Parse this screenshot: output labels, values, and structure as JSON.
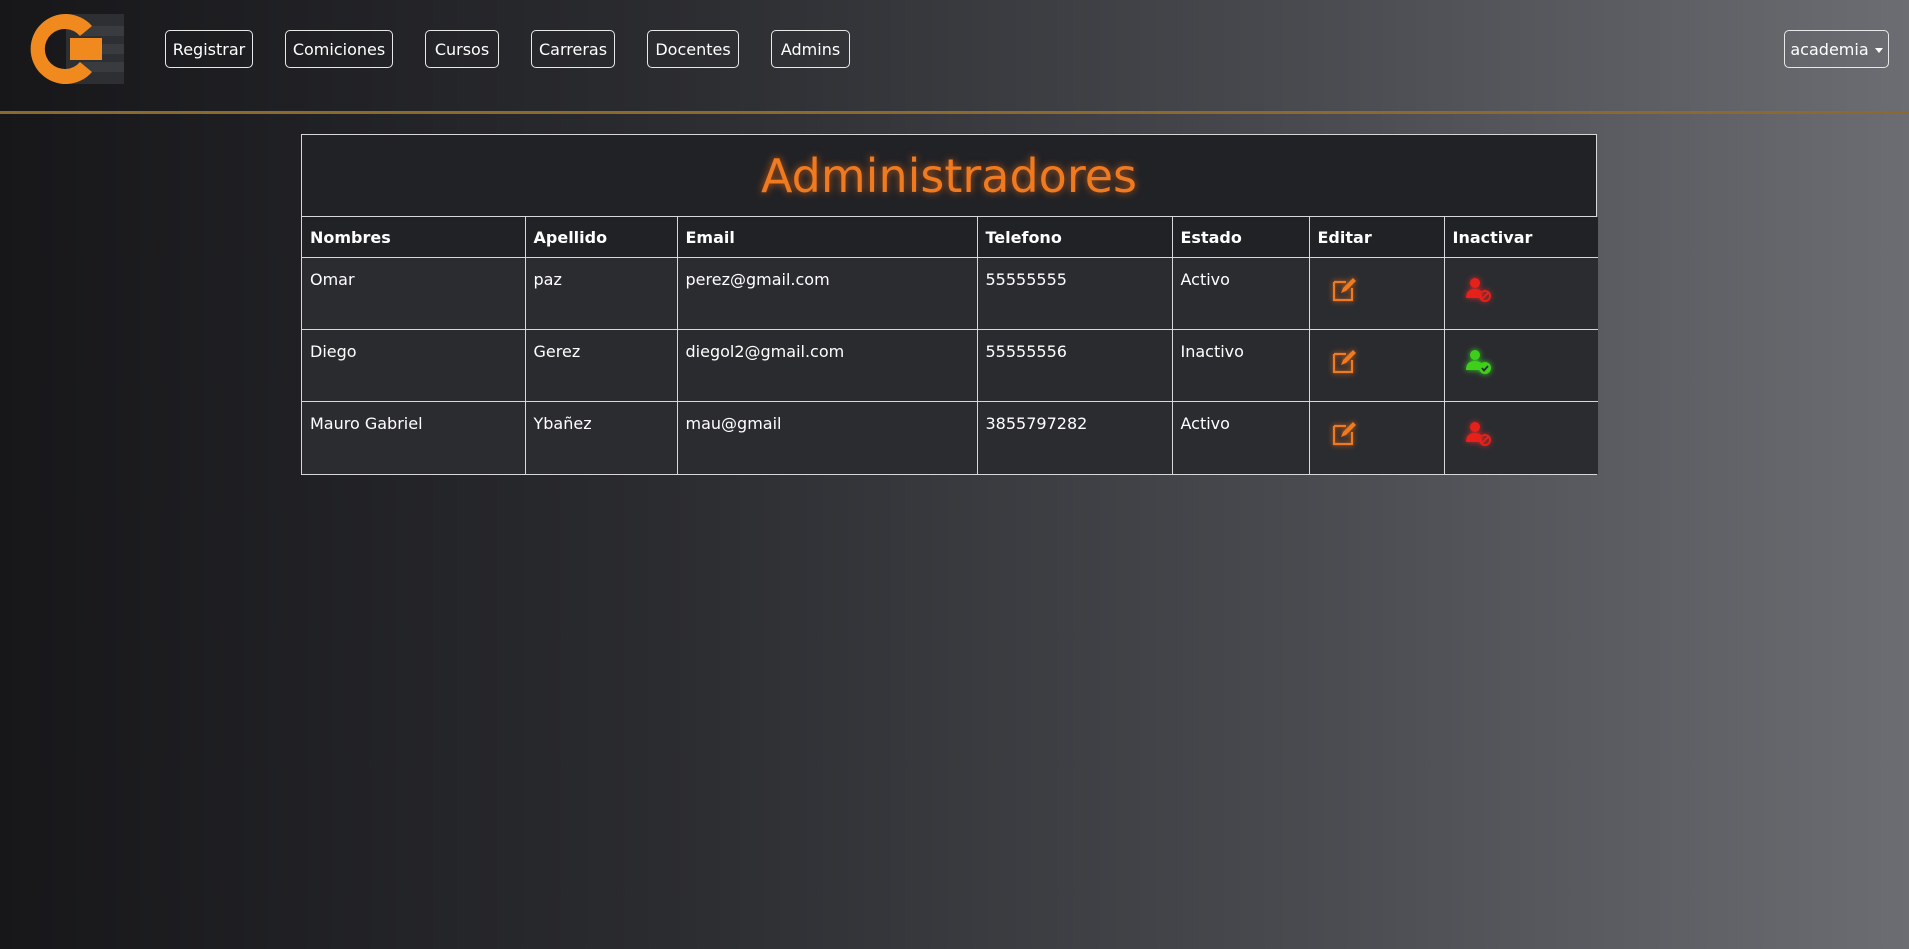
{
  "nav": {
    "items": [
      {
        "label": "Registrar"
      },
      {
        "label": "Comiciones"
      },
      {
        "label": "Cursos"
      },
      {
        "label": "Carreras"
      },
      {
        "label": "Docentes"
      },
      {
        "label": "Admins"
      }
    ],
    "user_menu": "academia"
  },
  "table": {
    "title": "Administradores",
    "headers": [
      "Nombres",
      "Apellido",
      "Email",
      "Telefono",
      "Estado",
      "Editar",
      "Inactivar"
    ],
    "rows": [
      {
        "nombres": "Omar",
        "apellido": "paz",
        "email": "perez@gmail.com",
        "telefono": "55555555",
        "estado": "Activo",
        "action_icon": "user-block-icon"
      },
      {
        "nombres": "Diego",
        "apellido": "Gerez",
        "email": "diegol2@gmail.com",
        "telefono": "55555556",
        "estado": "Inactivo",
        "action_icon": "user-check-icon"
      },
      {
        "nombres": "Mauro Gabriel",
        "apellido": "Ybañez",
        "email": "mau@gmail",
        "telefono": "3855797282",
        "estado": "Activo",
        "action_icon": "user-block-icon"
      }
    ]
  },
  "colors": {
    "accent": "#f07a1f",
    "inactivate": "#e8201a",
    "activate": "#3ecf1a",
    "divider": "#8a6a2f"
  }
}
